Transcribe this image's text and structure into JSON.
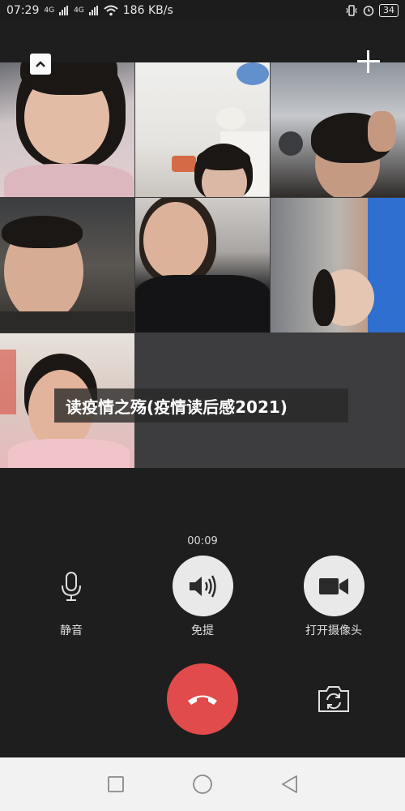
{
  "status_bar": {
    "time": "07:29",
    "signal_1": "4G",
    "signal_2": "4G",
    "net_speed": "186 KB/s",
    "battery": "34"
  },
  "caption": "读疫情之殇(疫情读后感2021)",
  "call": {
    "timer": "00:09"
  },
  "controls": {
    "mute_label": "静音",
    "speaker_label": "免提",
    "camera_label": "打开摄像头"
  },
  "icons": {
    "collapse": "chevron-up-icon",
    "add": "plus-icon",
    "mute": "microphone-icon",
    "speaker": "speaker-icon",
    "camera": "video-camera-icon",
    "hangup": "phone-hangup-icon",
    "switch_camera": "camera-switch-icon",
    "nav_recent": "square-icon",
    "nav_home": "circle-icon",
    "nav_back": "triangle-back-icon"
  },
  "colors": {
    "background": "#1e1e1e",
    "hangup": "#e24b4b",
    "control_circle": "#e9e9e9",
    "navbar": "#f2f2f2"
  }
}
